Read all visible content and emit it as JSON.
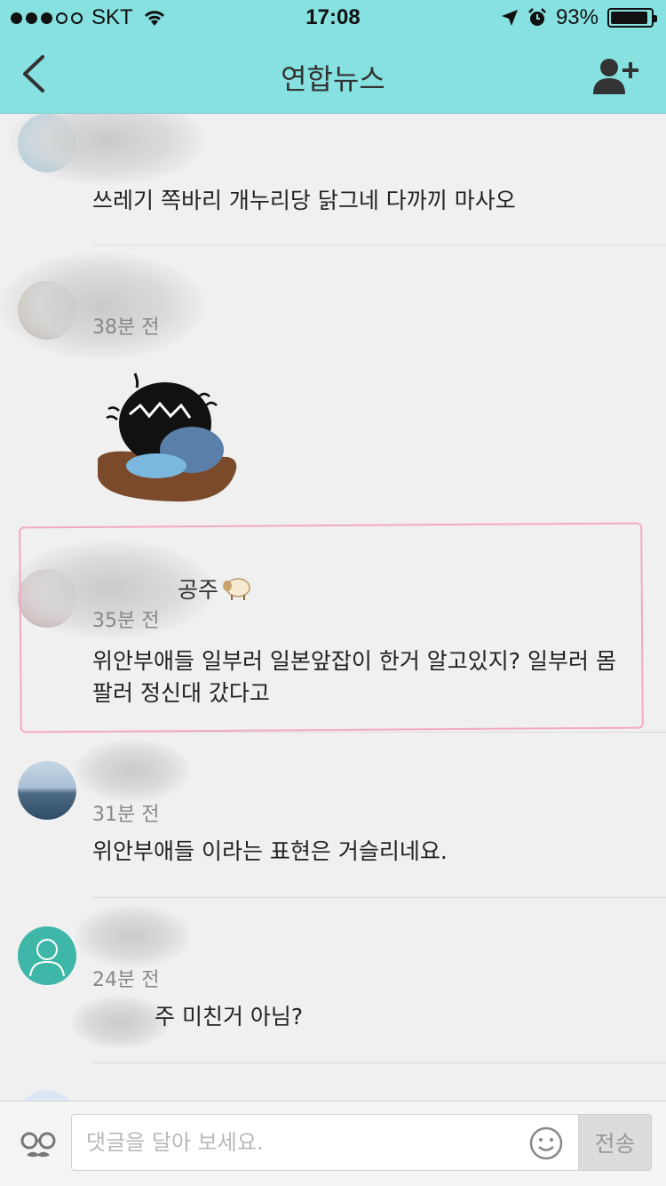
{
  "status_bar": {
    "carrier": "SKT",
    "time": "17:08",
    "battery_text": "93%",
    "battery_level": 0.93
  },
  "nav": {
    "title": "연합뉴스",
    "icons": {
      "back": "chevron-left-icon",
      "add_friend": "add-friend-icon"
    }
  },
  "comments": [
    {
      "author": "",
      "time": "",
      "text": "쓰레기 쪽바리 개누리당 닭그네 다까끼 마사오",
      "avatar": "blurred"
    },
    {
      "author": "",
      "time": "38분 전",
      "text": "",
      "attachment": "crying-character-sticker",
      "avatar": "blurred"
    },
    {
      "author": "공주",
      "time": "35분 전",
      "text": "위안부애들 일부러 일본앞잡이 한거 알고있지? 일부러 몸 팔러 정신대 갔다고",
      "highlighted": true,
      "avatar": "blurred",
      "badge": "sheep-emoji"
    },
    {
      "author": "",
      "time": "31분 전",
      "text": "위안부애들 이라는 표현은 거슬리네요.",
      "avatar": "landscape-photo"
    },
    {
      "author": "",
      "time": "24분 전",
      "text": "주 미친거 아님?",
      "avatar": "default-person"
    }
  ],
  "input_bar": {
    "placeholder": "댓글을 달아 보세요.",
    "value": "",
    "send_label": "전송",
    "icons": {
      "left": "glasses-mustache-icon",
      "emoji": "smile-icon"
    }
  },
  "colors": {
    "header_bg": "#86e1e0",
    "body_bg": "#f0f0f0",
    "highlight_border": "#f2a8c4"
  }
}
